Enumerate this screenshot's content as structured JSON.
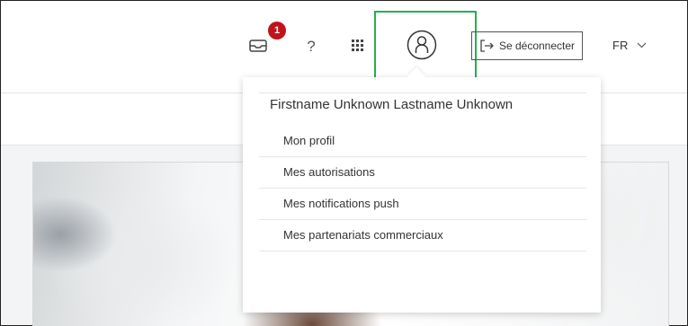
{
  "header": {
    "notifications_count": "1",
    "help_label": "?",
    "logout_label": "Se déconnecter",
    "language": "FR"
  },
  "user_menu": {
    "name": "Firstname Unknown Lastname Unknown",
    "items": [
      {
        "label": "Mon profil"
      },
      {
        "label": "Mes autorisations"
      },
      {
        "label": "Mes notifications push"
      },
      {
        "label": "Mes partenariats commerciaux"
      }
    ]
  },
  "colors": {
    "badge": "#c0141c",
    "highlight": "#22b14c"
  },
  "icons": [
    "mail-icon",
    "help-icon",
    "apps-grid-icon",
    "user-icon",
    "logout-icon",
    "chevron-down-icon"
  ]
}
